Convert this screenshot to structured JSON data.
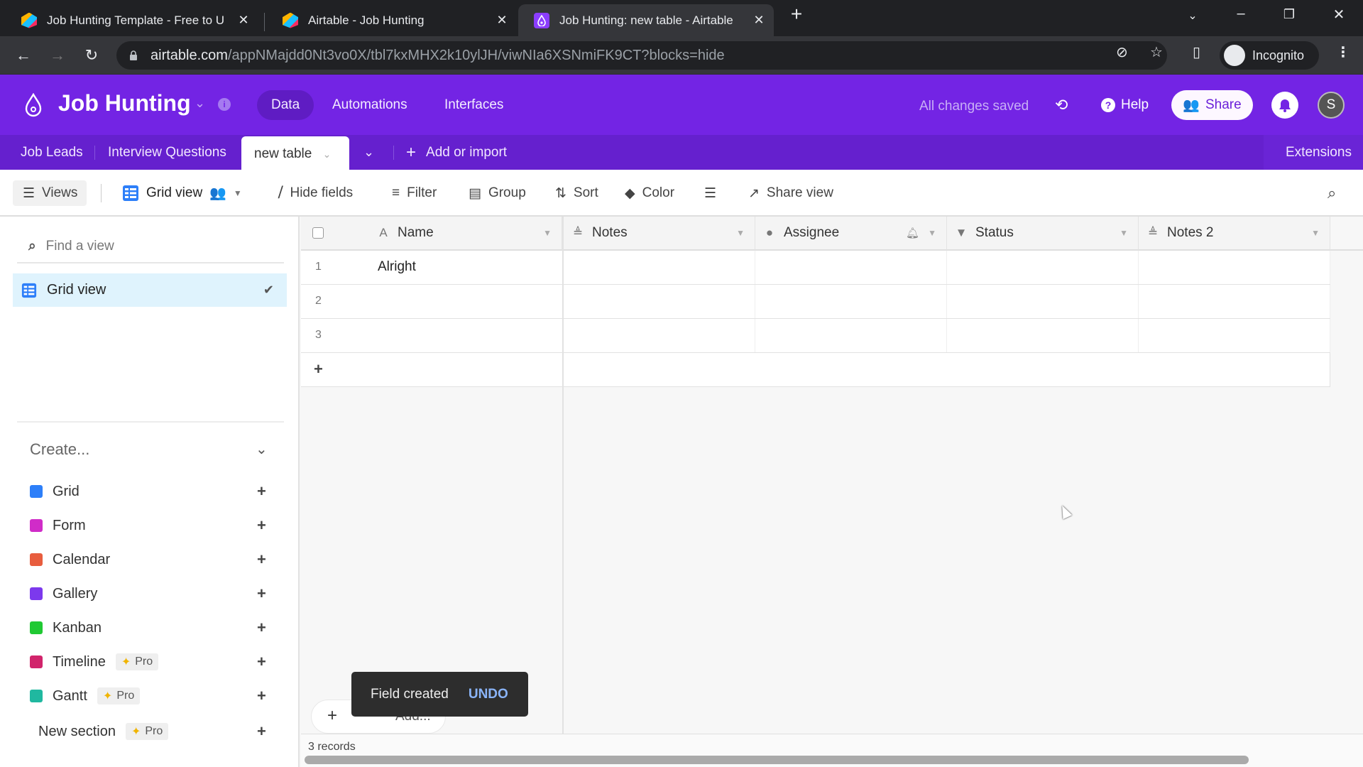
{
  "browser": {
    "tabs": [
      {
        "title": "Job Hunting Template - Free to U",
        "favicon": "airtable-logo-icon",
        "active": false
      },
      {
        "title": "Airtable - Job Hunting",
        "favicon": "airtable-logo-icon",
        "active": false
      },
      {
        "title": "Job Hunting: new table - Airtable",
        "favicon": "base-drop-icon",
        "active": true
      }
    ],
    "new_tab_label": "+",
    "url_host": "airtable.com",
    "url_path": "/appNMajdd0Nt3vo0X/tbl7kxMHX2k10ylJH/viwNIa6XSNmiFK9CT?blocks=hide",
    "profile_label": "Incognito"
  },
  "app": {
    "base_name": "Job Hunting",
    "nav": [
      {
        "label": "Data",
        "active": true
      },
      {
        "label": "Automations",
        "active": false
      },
      {
        "label": "Interfaces",
        "active": false
      }
    ],
    "save_status": "All changes saved",
    "help_label": "Help",
    "share_label": "Share",
    "avatar_initial": "S",
    "brand_color": "#7324e4"
  },
  "table_tabs": {
    "tabs": [
      {
        "label": "Job Leads",
        "active": false
      },
      {
        "label": "Interview Questions",
        "active": false
      },
      {
        "label": "new table",
        "active": true
      }
    ],
    "add_label": "Add or import",
    "extensions_label": "Extensions"
  },
  "toolbar": {
    "views_label": "Views",
    "view_name": "Grid view",
    "hide_fields": "Hide fields",
    "filter": "Filter",
    "group": "Group",
    "sort": "Sort",
    "color": "Color",
    "share_view": "Share view"
  },
  "sidebar": {
    "find_placeholder": "Find a view",
    "views": [
      {
        "label": "Grid view",
        "selected": true
      }
    ],
    "create_label": "Create...",
    "create_items": [
      {
        "label": "Grid",
        "icon": "grid-view-icon",
        "color": "#2d7ff9",
        "pro": false
      },
      {
        "label": "Form",
        "icon": "form-view-icon",
        "color": "#d02cc8",
        "pro": false
      },
      {
        "label": "Calendar",
        "icon": "calendar-view-icon",
        "color": "#e85d3e",
        "pro": false
      },
      {
        "label": "Gallery",
        "icon": "gallery-view-icon",
        "color": "#7c39ed",
        "pro": false
      },
      {
        "label": "Kanban",
        "icon": "kanban-view-icon",
        "color": "#20c933",
        "pro": false
      },
      {
        "label": "Timeline",
        "icon": "timeline-view-icon",
        "color": "#d1246b",
        "pro": true
      },
      {
        "label": "Gantt",
        "icon": "gantt-view-icon",
        "color": "#20b8a0",
        "pro": true
      }
    ],
    "new_section_label": "New section",
    "pro_label": "Pro"
  },
  "grid": {
    "columns": [
      {
        "name": "Name",
        "type_icon": "text-field-icon"
      },
      {
        "name": "Notes",
        "type_icon": "long-text-field-icon"
      },
      {
        "name": "Assignee",
        "type_icon": "user-field-icon"
      },
      {
        "name": "Status",
        "type_icon": "single-select-field-icon"
      },
      {
        "name": "Notes 2",
        "type_icon": "long-text-field-icon"
      }
    ],
    "rows": [
      {
        "num": "1",
        "Name": "Alright",
        "Notes": "",
        "Assignee": "",
        "Status": "",
        "Notes 2": ""
      },
      {
        "num": "2",
        "Name": "",
        "Notes": "",
        "Assignee": "",
        "Status": "",
        "Notes 2": ""
      },
      {
        "num": "3",
        "Name": "",
        "Notes": "",
        "Assignee": "",
        "Status": "",
        "Notes 2": ""
      }
    ],
    "add_row_label": "+",
    "record_count": "3 records",
    "add_label": "Add..."
  },
  "toast": {
    "message": "Field created",
    "action": "UNDO"
  }
}
